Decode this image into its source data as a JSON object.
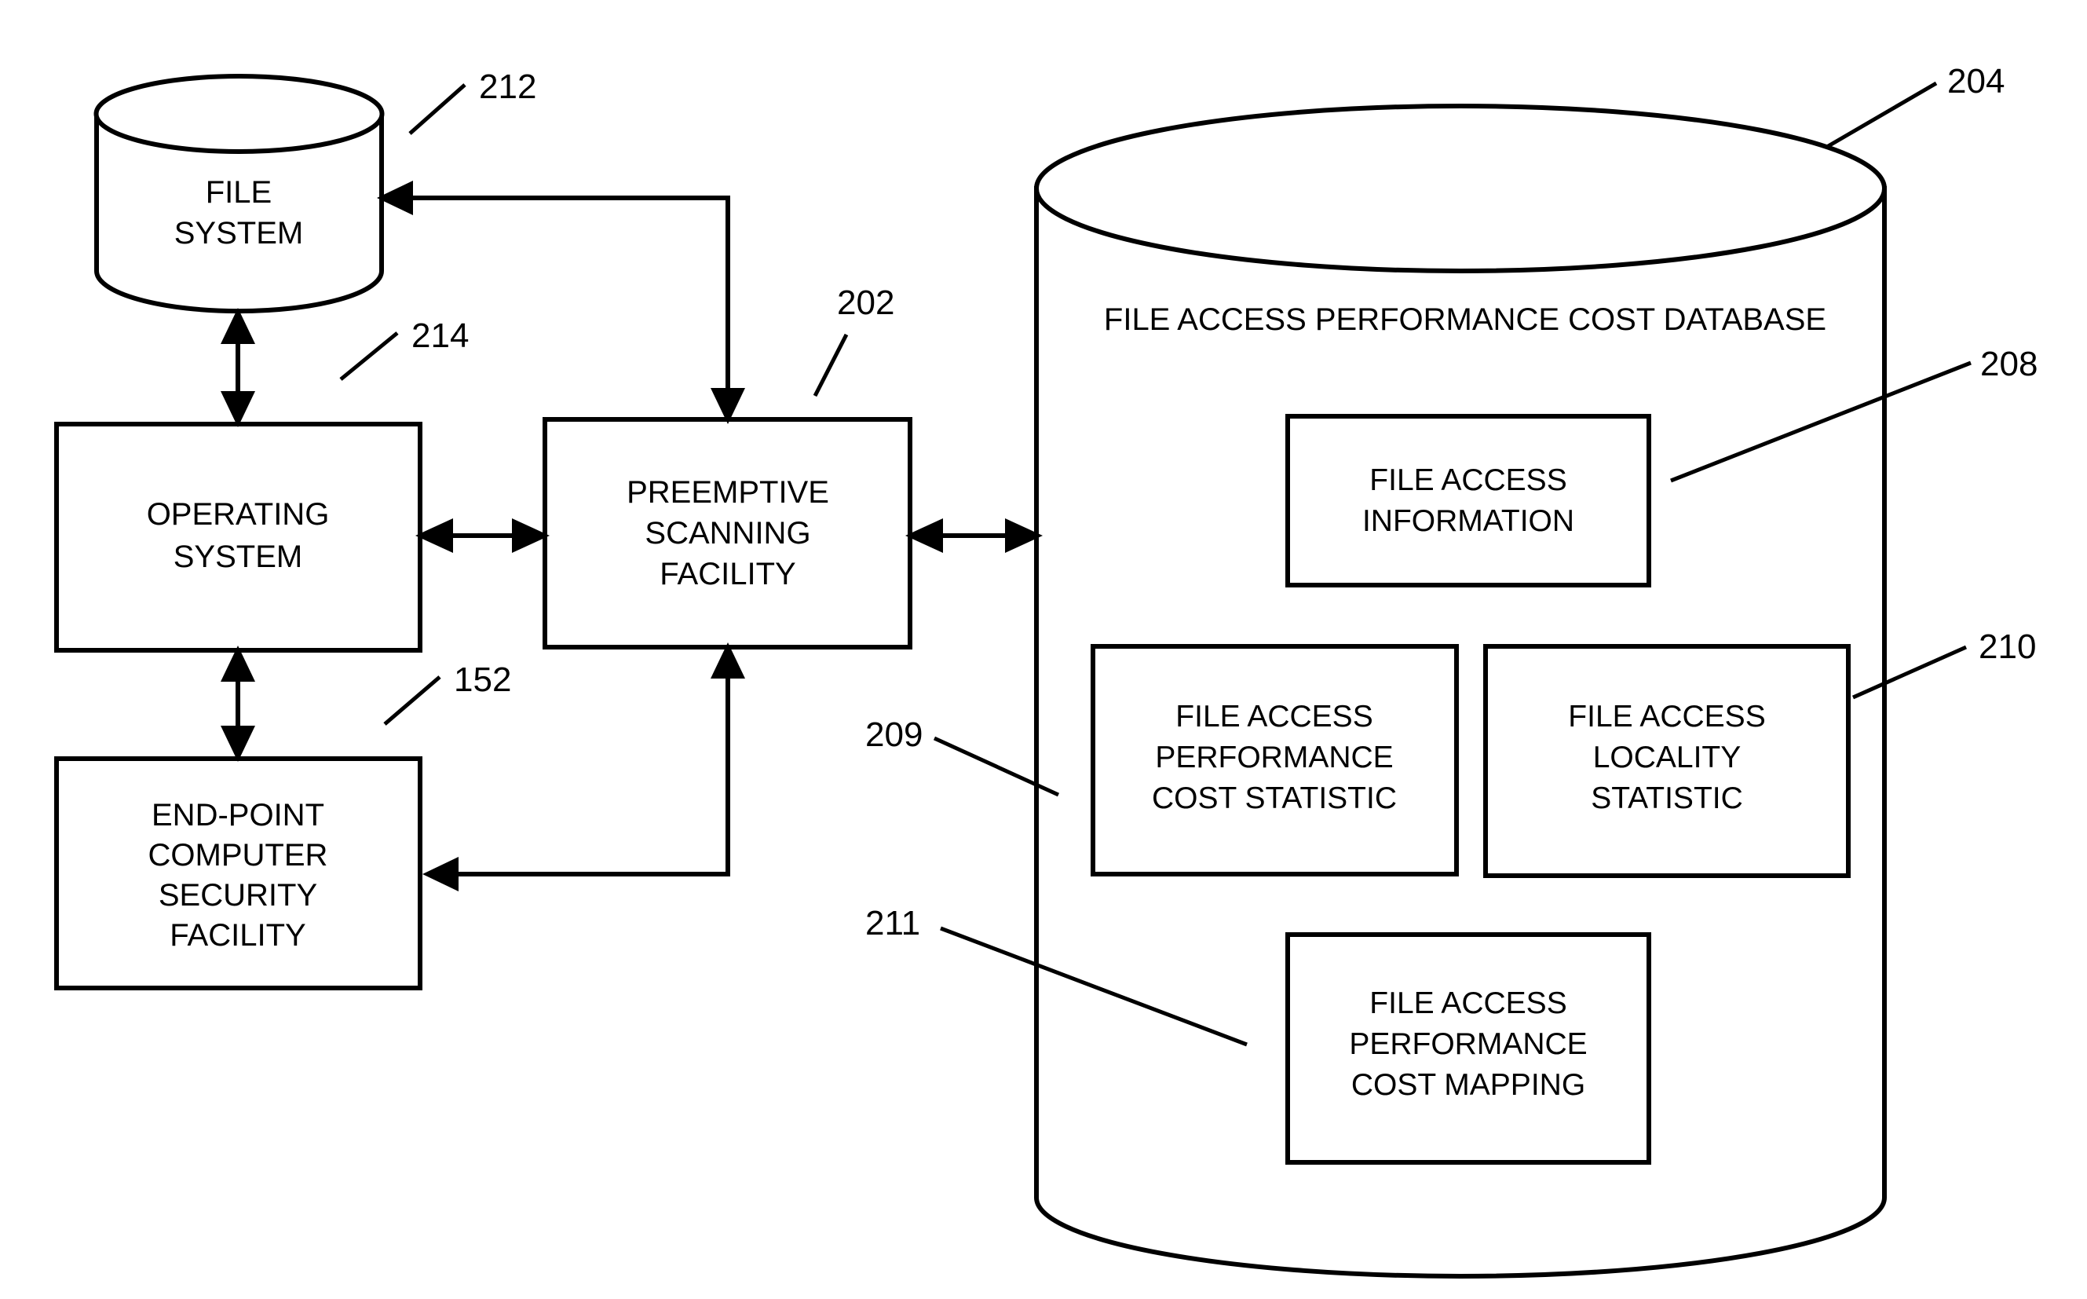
{
  "figure": {
    "type": "patent-block-diagram",
    "background_color": "#ffffff",
    "line_color": "#000000"
  },
  "nodes": {
    "file_system": {
      "label_line1": "FILE",
      "label_line2": "SYSTEM",
      "shape": "cylinder",
      "ref": "212"
    },
    "operating_system": {
      "label_line1": "OPERATING",
      "label_line2": "SYSTEM",
      "shape": "rectangle",
      "ref": "214"
    },
    "preemptive_scanning_facility": {
      "label_line1": "PREEMPTIVE",
      "label_line2": "SCANNING",
      "label_line3": "FACILITY",
      "shape": "rectangle",
      "ref": "202"
    },
    "end_point_security_facility": {
      "label_line1": "END-POINT",
      "label_line2": "COMPUTER",
      "label_line3": "SECURITY",
      "label_line4": "FACILITY",
      "shape": "rectangle",
      "ref": "152"
    },
    "database": {
      "title": "FILE ACCESS PERFORMANCE COST DATABASE",
      "shape": "cylinder",
      "ref": "204"
    },
    "file_access_information": {
      "label_line1": "FILE ACCESS",
      "label_line2": "INFORMATION",
      "shape": "rectangle",
      "ref": "208"
    },
    "file_access_performance_cost_statistic": {
      "label_line1": "FILE ACCESS",
      "label_line2": "PERFORMANCE",
      "label_line3": "COST STATISTIC",
      "shape": "rectangle",
      "ref": "209"
    },
    "file_access_locality_statistic": {
      "label_line1": "FILE ACCESS",
      "label_line2": "LOCALITY",
      "label_line3": "STATISTIC",
      "shape": "rectangle",
      "ref": "210"
    },
    "file_access_performance_cost_mapping": {
      "label_line1": "FILE ACCESS",
      "label_line2": "PERFORMANCE",
      "label_line3": "COST MAPPING",
      "shape": "rectangle",
      "ref": "211"
    }
  },
  "reference_numerals": {
    "r212": "212",
    "r214": "214",
    "r202": "202",
    "r152": "152",
    "r204": "204",
    "r208": "208",
    "r209": "209",
    "r210": "210",
    "r211": "211"
  },
  "connections": [
    {
      "name": "file-system-to-operating-system",
      "from": "file_system",
      "to": "operating_system",
      "style": "double-arrow-vertical"
    },
    {
      "name": "operating-system-to-end-point",
      "from": "operating_system",
      "to": "end_point_security_facility",
      "style": "double-arrow-vertical"
    },
    {
      "name": "operating-system-to-scanning-facility",
      "from": "operating_system",
      "to": "preemptive_scanning_facility",
      "style": "double-arrow-horizontal"
    },
    {
      "name": "scanning-facility-to-database",
      "from": "preemptive_scanning_facility",
      "to": "database",
      "style": "double-arrow-horizontal"
    },
    {
      "name": "scanning-facility-to-file-system",
      "from": "preemptive_scanning_facility",
      "to": "file_system",
      "style": "single-arrow-routed"
    },
    {
      "name": "scanning-facility-to-end-point",
      "from": "preemptive_scanning_facility",
      "to": "end_point_security_facility",
      "style": "single-arrow-routed"
    }
  ]
}
